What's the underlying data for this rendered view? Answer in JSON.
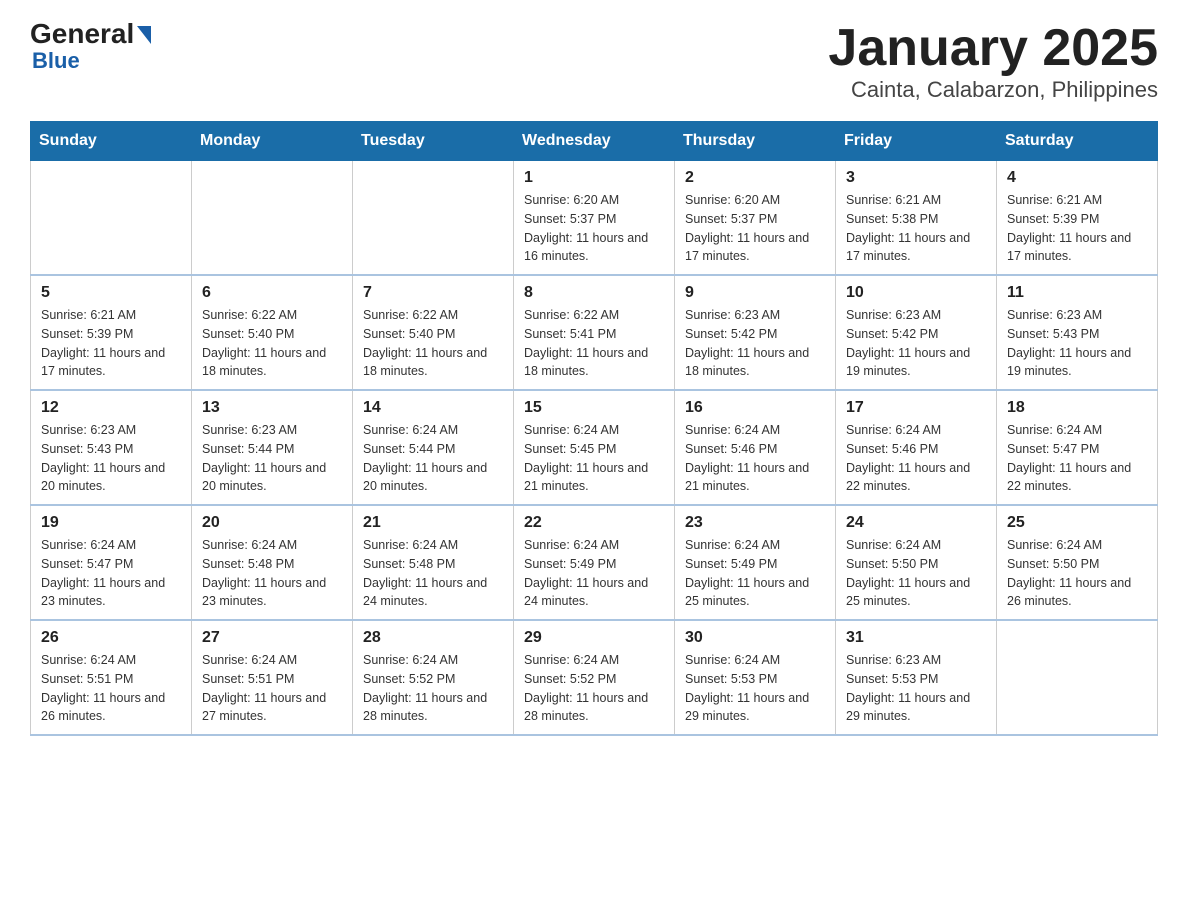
{
  "header": {
    "logo": {
      "general": "General",
      "blue": "Blue"
    },
    "title": "January 2025",
    "subtitle": "Cainta, Calabarzon, Philippines"
  },
  "days_of_week": [
    "Sunday",
    "Monday",
    "Tuesday",
    "Wednesday",
    "Thursday",
    "Friday",
    "Saturday"
  ],
  "weeks": [
    [
      {
        "day": "",
        "info": ""
      },
      {
        "day": "",
        "info": ""
      },
      {
        "day": "",
        "info": ""
      },
      {
        "day": "1",
        "info": "Sunrise: 6:20 AM\nSunset: 5:37 PM\nDaylight: 11 hours and 16 minutes."
      },
      {
        "day": "2",
        "info": "Sunrise: 6:20 AM\nSunset: 5:37 PM\nDaylight: 11 hours and 17 minutes."
      },
      {
        "day": "3",
        "info": "Sunrise: 6:21 AM\nSunset: 5:38 PM\nDaylight: 11 hours and 17 minutes."
      },
      {
        "day": "4",
        "info": "Sunrise: 6:21 AM\nSunset: 5:39 PM\nDaylight: 11 hours and 17 minutes."
      }
    ],
    [
      {
        "day": "5",
        "info": "Sunrise: 6:21 AM\nSunset: 5:39 PM\nDaylight: 11 hours and 17 minutes."
      },
      {
        "day": "6",
        "info": "Sunrise: 6:22 AM\nSunset: 5:40 PM\nDaylight: 11 hours and 18 minutes."
      },
      {
        "day": "7",
        "info": "Sunrise: 6:22 AM\nSunset: 5:40 PM\nDaylight: 11 hours and 18 minutes."
      },
      {
        "day": "8",
        "info": "Sunrise: 6:22 AM\nSunset: 5:41 PM\nDaylight: 11 hours and 18 minutes."
      },
      {
        "day": "9",
        "info": "Sunrise: 6:23 AM\nSunset: 5:42 PM\nDaylight: 11 hours and 18 minutes."
      },
      {
        "day": "10",
        "info": "Sunrise: 6:23 AM\nSunset: 5:42 PM\nDaylight: 11 hours and 19 minutes."
      },
      {
        "day": "11",
        "info": "Sunrise: 6:23 AM\nSunset: 5:43 PM\nDaylight: 11 hours and 19 minutes."
      }
    ],
    [
      {
        "day": "12",
        "info": "Sunrise: 6:23 AM\nSunset: 5:43 PM\nDaylight: 11 hours and 20 minutes."
      },
      {
        "day": "13",
        "info": "Sunrise: 6:23 AM\nSunset: 5:44 PM\nDaylight: 11 hours and 20 minutes."
      },
      {
        "day": "14",
        "info": "Sunrise: 6:24 AM\nSunset: 5:44 PM\nDaylight: 11 hours and 20 minutes."
      },
      {
        "day": "15",
        "info": "Sunrise: 6:24 AM\nSunset: 5:45 PM\nDaylight: 11 hours and 21 minutes."
      },
      {
        "day": "16",
        "info": "Sunrise: 6:24 AM\nSunset: 5:46 PM\nDaylight: 11 hours and 21 minutes."
      },
      {
        "day": "17",
        "info": "Sunrise: 6:24 AM\nSunset: 5:46 PM\nDaylight: 11 hours and 22 minutes."
      },
      {
        "day": "18",
        "info": "Sunrise: 6:24 AM\nSunset: 5:47 PM\nDaylight: 11 hours and 22 minutes."
      }
    ],
    [
      {
        "day": "19",
        "info": "Sunrise: 6:24 AM\nSunset: 5:47 PM\nDaylight: 11 hours and 23 minutes."
      },
      {
        "day": "20",
        "info": "Sunrise: 6:24 AM\nSunset: 5:48 PM\nDaylight: 11 hours and 23 minutes."
      },
      {
        "day": "21",
        "info": "Sunrise: 6:24 AM\nSunset: 5:48 PM\nDaylight: 11 hours and 24 minutes."
      },
      {
        "day": "22",
        "info": "Sunrise: 6:24 AM\nSunset: 5:49 PM\nDaylight: 11 hours and 24 minutes."
      },
      {
        "day": "23",
        "info": "Sunrise: 6:24 AM\nSunset: 5:49 PM\nDaylight: 11 hours and 25 minutes."
      },
      {
        "day": "24",
        "info": "Sunrise: 6:24 AM\nSunset: 5:50 PM\nDaylight: 11 hours and 25 minutes."
      },
      {
        "day": "25",
        "info": "Sunrise: 6:24 AM\nSunset: 5:50 PM\nDaylight: 11 hours and 26 minutes."
      }
    ],
    [
      {
        "day": "26",
        "info": "Sunrise: 6:24 AM\nSunset: 5:51 PM\nDaylight: 11 hours and 26 minutes."
      },
      {
        "day": "27",
        "info": "Sunrise: 6:24 AM\nSunset: 5:51 PM\nDaylight: 11 hours and 27 minutes."
      },
      {
        "day": "28",
        "info": "Sunrise: 6:24 AM\nSunset: 5:52 PM\nDaylight: 11 hours and 28 minutes."
      },
      {
        "day": "29",
        "info": "Sunrise: 6:24 AM\nSunset: 5:52 PM\nDaylight: 11 hours and 28 minutes."
      },
      {
        "day": "30",
        "info": "Sunrise: 6:24 AM\nSunset: 5:53 PM\nDaylight: 11 hours and 29 minutes."
      },
      {
        "day": "31",
        "info": "Sunrise: 6:23 AM\nSunset: 5:53 PM\nDaylight: 11 hours and 29 minutes."
      },
      {
        "day": "",
        "info": ""
      }
    ]
  ]
}
